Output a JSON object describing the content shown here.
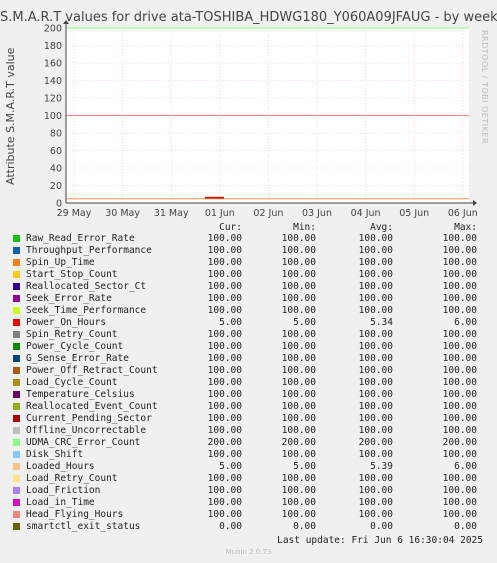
{
  "chart_data": {
    "type": "line",
    "title": "S.M.A.R.T values for drive ata-TOSHIBA_HDWG180_Y060A09JFAUG - by week",
    "ylabel": "Attribute S.M.A.R.T value",
    "side_label": "RRDTOOL / TOBI OETIKER",
    "ylim": [
      0,
      200
    ],
    "y_ticks": [
      "0",
      "20",
      "40",
      "60",
      "80",
      "100",
      "120",
      "140",
      "160",
      "180",
      "200"
    ],
    "x_ticks": [
      "29 May",
      "30 May",
      "31 May",
      "01 Jun",
      "02 Jun",
      "03 Jun",
      "04 Jun",
      "05 Jun",
      "06 Jun"
    ],
    "columns": [
      "Cur:",
      "Min:",
      "Avg:",
      "Max:"
    ],
    "series": [
      {
        "name": "Raw_Read_Error_Rate",
        "color": "#00cc00",
        "cur": "100.00",
        "min": "100.00",
        "avg": "100.00",
        "max": "100.00"
      },
      {
        "name": "Throughput_Performance",
        "color": "#0066b3",
        "cur": "100.00",
        "min": "100.00",
        "avg": "100.00",
        "max": "100.00"
      },
      {
        "name": "Spin_Up_Time",
        "color": "#ff8000",
        "cur": "100.00",
        "min": "100.00",
        "avg": "100.00",
        "max": "100.00"
      },
      {
        "name": "Start_Stop_Count",
        "color": "#ffcc00",
        "cur": "100.00",
        "min": "100.00",
        "avg": "100.00",
        "max": "100.00"
      },
      {
        "name": "Reallocated_Sector_Ct",
        "color": "#330099",
        "cur": "100.00",
        "min": "100.00",
        "avg": "100.00",
        "max": "100.00"
      },
      {
        "name": "Seek_Error_Rate",
        "color": "#990099",
        "cur": "100.00",
        "min": "100.00",
        "avg": "100.00",
        "max": "100.00"
      },
      {
        "name": "Seek_Time_Performance",
        "color": "#ccff00",
        "cur": "100.00",
        "min": "100.00",
        "avg": "100.00",
        "max": "100.00"
      },
      {
        "name": "Power_On_Hours",
        "color": "#ff0000",
        "cur": "5.00",
        "min": "5.00",
        "avg": "5.34",
        "max": "6.00"
      },
      {
        "name": "Spin_Retry_Count",
        "color": "#808080",
        "cur": "100.00",
        "min": "100.00",
        "avg": "100.00",
        "max": "100.00"
      },
      {
        "name": "Power_Cycle_Count",
        "color": "#008f00",
        "cur": "100.00",
        "min": "100.00",
        "avg": "100.00",
        "max": "100.00"
      },
      {
        "name": "G_Sense_Error_Rate",
        "color": "#00487d",
        "cur": "100.00",
        "min": "100.00",
        "avg": "100.00",
        "max": "100.00"
      },
      {
        "name": "Power_Off_Retract_Count",
        "color": "#b35a00",
        "cur": "100.00",
        "min": "100.00",
        "avg": "100.00",
        "max": "100.00"
      },
      {
        "name": "Load_Cycle_Count",
        "color": "#b38f00",
        "cur": "100.00",
        "min": "100.00",
        "avg": "100.00",
        "max": "100.00"
      },
      {
        "name": "Temperature_Celsius",
        "color": "#6b006b",
        "cur": "100.00",
        "min": "100.00",
        "avg": "100.00",
        "max": "100.00"
      },
      {
        "name": "Reallocated_Event_Count",
        "color": "#8fb300",
        "cur": "100.00",
        "min": "100.00",
        "avg": "100.00",
        "max": "100.00"
      },
      {
        "name": "Current_Pending_Sector",
        "color": "#b30000",
        "cur": "100.00",
        "min": "100.00",
        "avg": "100.00",
        "max": "100.00"
      },
      {
        "name": "Offline_Uncorrectable",
        "color": "#bebebe",
        "cur": "100.00",
        "min": "100.00",
        "avg": "100.00",
        "max": "100.00"
      },
      {
        "name": "UDMA_CRC_Error_Count",
        "color": "#80ff80",
        "cur": "200.00",
        "min": "200.00",
        "avg": "200.00",
        "max": "200.00"
      },
      {
        "name": "Disk_Shift",
        "color": "#80c9ff",
        "cur": "100.00",
        "min": "100.00",
        "avg": "100.00",
        "max": "100.00"
      },
      {
        "name": "Loaded_Hours",
        "color": "#ffc080",
        "cur": "5.00",
        "min": "5.00",
        "avg": "5.39",
        "max": "6.00"
      },
      {
        "name": "Load_Retry_Count",
        "color": "#ffe680",
        "cur": "100.00",
        "min": "100.00",
        "avg": "100.00",
        "max": "100.00"
      },
      {
        "name": "Load_Friction",
        "color": "#aa80ff",
        "cur": "100.00",
        "min": "100.00",
        "avg": "100.00",
        "max": "100.00"
      },
      {
        "name": "Load_in_Time",
        "color": "#ee00cc",
        "cur": "100.00",
        "min": "100.00",
        "avg": "100.00",
        "max": "100.00"
      },
      {
        "name": "Head_Flying_Hours",
        "color": "#ff8080",
        "cur": "100.00",
        "min": "100.00",
        "avg": "100.00",
        "max": "100.00"
      },
      {
        "name": "smartctl_exit_status",
        "color": "#666600",
        "cur": "0.00",
        "min": "0.00",
        "avg": "0.00",
        "max": "0.00"
      }
    ]
  },
  "footer": {
    "last_update": "Last update: Fri Jun  6 16:30:04 2025",
    "version": "Munin 2.0.73"
  }
}
